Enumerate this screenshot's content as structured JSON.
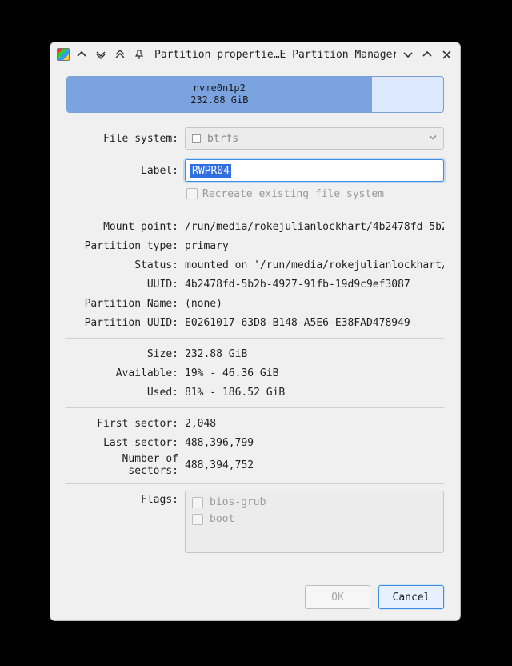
{
  "titlebar": {
    "title": "Partition propertie…E Partition Manager"
  },
  "partition_visual": {
    "name": "nvme0n1p2",
    "size": "232.88 GiB",
    "used_percent": 81
  },
  "form": {
    "filesystem": {
      "label": "File system:",
      "value": "btrfs"
    },
    "label_field": {
      "label": "Label:",
      "value": "RWPR04"
    },
    "recreate": {
      "label": "Recreate existing file system"
    },
    "mount_point": {
      "label": "Mount point:",
      "value": "/run/media/rokejulianlockhart/4b2478fd-5b2"
    },
    "partition_type": {
      "label": "Partition type:",
      "value": "primary"
    },
    "status": {
      "label": "Status:",
      "value": "mounted on '/run/media/rokejulianlockhart/"
    },
    "uuid": {
      "label": "UUID:",
      "value": "4b2478fd-5b2b-4927-91fb-19d9c9ef3087"
    },
    "partition_name": {
      "label": "Partition Name:",
      "value": "(none)"
    },
    "partition_uuid": {
      "label": "Partition UUID:",
      "value": "E0261017-63D8-B148-A5E6-E38FAD478949"
    },
    "size": {
      "label": "Size:",
      "value": "232.88 GiB"
    },
    "available": {
      "label": "Available:",
      "value": "19% - 46.36 GiB"
    },
    "used": {
      "label": "Used:",
      "value": "81% - 186.52 GiB"
    },
    "first_sector": {
      "label": "First sector:",
      "value": "2,048"
    },
    "last_sector": {
      "label": "Last sector:",
      "value": "488,396,799"
    },
    "num_sectors": {
      "label": "Number of sectors:",
      "value": "488,394,752"
    },
    "flags": {
      "label": "Flags:",
      "items": [
        "bios-grub",
        "boot"
      ]
    }
  },
  "buttons": {
    "ok": "OK",
    "cancel": "Cancel"
  }
}
